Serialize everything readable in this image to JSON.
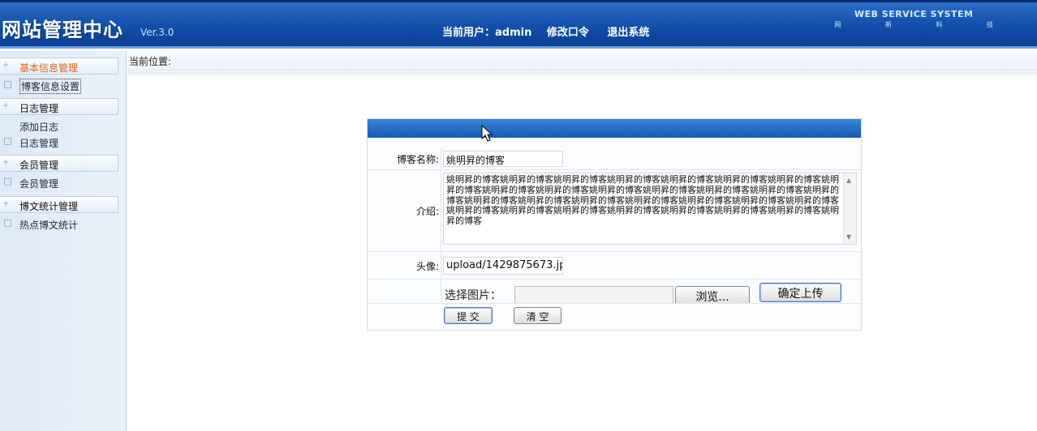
{
  "header": {
    "logo": "网站管理中心",
    "version": "Ver.3.0",
    "current_user_label": "当前用户：admin",
    "change_password": "修改口令",
    "logout": "退出系统",
    "brand_title": "WEB SERVICE SYSTEM",
    "brand_sub": "网 新 科 技"
  },
  "sidebar": {
    "items": [
      {
        "type": "head",
        "label": "基本信息管理",
        "active": true
      },
      {
        "type": "item",
        "label": "博客信息设置",
        "selected": true
      },
      {
        "type": "head",
        "label": "日志管理"
      },
      {
        "type": "item",
        "label": "添加日志",
        "nobox": true
      },
      {
        "type": "item",
        "label": "日志管理"
      },
      {
        "type": "head",
        "label": "会员管理"
      },
      {
        "type": "item",
        "label": "会员管理"
      },
      {
        "type": "head",
        "label": "博文统计管理"
      },
      {
        "type": "item",
        "label": "热点博文统计"
      }
    ]
  },
  "breadcrumb": "当前位置:",
  "form": {
    "blog_name_label": "博客名称:",
    "blog_name_value": "姚明昇的博客",
    "intro_label": "介绍:",
    "intro_value": "姚明昇的博客姚明昇的博客姚明昇的博客姚明昇的博客姚明昇的博客姚明昇的博客姚明昇的博客姚明昇的博客姚明昇的博客姚明昇的博客姚明昇的博客姚明昇的博客姚明昇的博客姚明昇的博客姚明昇的博客姚明昇的博客姚明昇的博客姚明昇的博客姚明昇的博客姚明昇的博客姚明昇的博客姚明昇的博客姚明昇的博客姚明昇的博客姚明昇的博客姚明昇的博客姚明昇的博客姚明昇的博客姚明昇的博客姚明昇的博客",
    "avatar_label": "头像:",
    "avatar_value": "upload/1429875673.jp",
    "choose_image_label": "选择图片：",
    "browse_button": "浏览...",
    "upload_button": "确定上传",
    "submit_button": "提 交",
    "clear_button": "清 空"
  },
  "colors": {
    "header_blue": "#1453ae",
    "panel_bar_blue": "#135bb8",
    "active_menu": "#e0611a"
  }
}
